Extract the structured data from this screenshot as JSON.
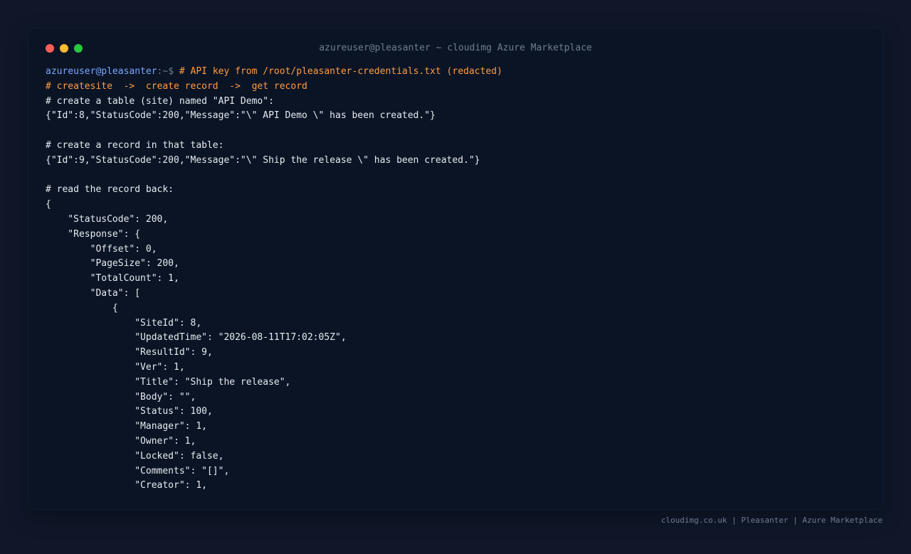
{
  "window": {
    "title": "azureuser@pleasanter ~ cloudimg Azure Marketplace",
    "controls": {
      "close_color": "#ff5f57",
      "minimize_color": "#febc2e",
      "maximize_color": "#28c840"
    }
  },
  "terminal": {
    "prompt_user": "azureuser@pleasanter",
    "prompt_sep": ":~$ ",
    "command": "# API key from /root/pleasanter-credentials.txt (redacted)",
    "comment_flow": "# createsite  ->  create record  ->  get record",
    "output_lines": [
      "# create a table (site) named \"API Demo\":",
      "{\"Id\":8,\"StatusCode\":200,\"Message\":\"\\\" API Demo \\\" has been created.\"}",
      "",
      "# create a record in that table:",
      "{\"Id\":9,\"StatusCode\":200,\"Message\":\"\\\" Ship the release \\\" has been created.\"}",
      "",
      "# read the record back:",
      "{",
      "    \"StatusCode\": 200,",
      "    \"Response\": {",
      "        \"Offset\": 0,",
      "        \"PageSize\": 200,",
      "        \"TotalCount\": 1,",
      "        \"Data\": [",
      "            {",
      "                \"SiteId\": 8,",
      "                \"UpdatedTime\": \"2026-08-11T17:02:05Z\",",
      "                \"ResultId\": 9,",
      "                \"Ver\": 1,",
      "                \"Title\": \"Ship the release\",",
      "                \"Body\": \"\",",
      "                \"Status\": 100,",
      "                \"Manager\": 1,",
      "                \"Owner\": 1,",
      "                \"Locked\": false,",
      "                \"Comments\": \"[]\",",
      "                \"Creator\": 1,"
    ]
  },
  "footer": {
    "text": "cloudimg.co.uk | Pleasanter | Azure Marketplace"
  },
  "colors": {
    "page_background": "#0f1729",
    "terminal_background": "#0b1425",
    "prompt_user": "#7aa7ff",
    "comment_accent": "#ff9d42",
    "text": "#e6ebf2",
    "muted": "#6f7c91"
  }
}
